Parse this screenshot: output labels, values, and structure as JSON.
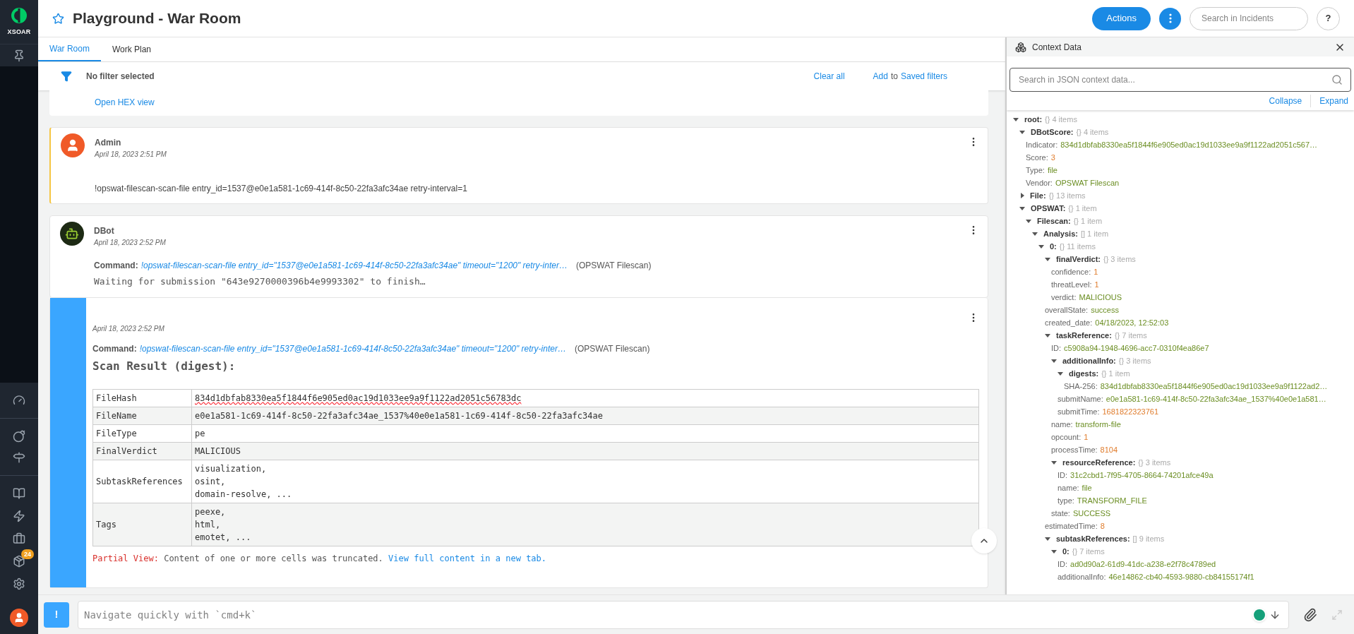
{
  "sidebar": {
    "logo_text": "XSOAR",
    "badge": "24"
  },
  "header": {
    "title": "Playground - War Room",
    "actions_button": "Actions",
    "search": {
      "placeholder": "Search in Incidents"
    },
    "help_button": "?"
  },
  "tabs": [
    {
      "label": "War Room",
      "selected": true
    },
    {
      "label": "Work Plan",
      "selected": false
    }
  ],
  "filter_bar": {
    "status": "No filter selected",
    "clear_all": "Clear all",
    "add": "Add",
    "to": "to",
    "saved_filters": "Saved filters"
  },
  "entries": [
    {
      "kind": "link",
      "link": "Open HEX view"
    },
    {
      "kind": "user",
      "author": "Admin",
      "time": "April 18, 2023 2:51 PM",
      "text": "!opswat-filescan-scan-file entry_id=1537@e0e1a581-1c69-414f-8c50-22fa3afc34ae retry-interval=1"
    },
    {
      "kind": "bot",
      "author": "DBot",
      "time": "April 18, 2023 2:52 PM",
      "command_label": "Command:",
      "command": "!opswat-filescan-scan-file entry_id=\"1537@e0e1a581-1c69-414f-8c50-22fa3afc34ae\" timeout=\"1200\" retry-inter…",
      "source": "(OPSWAT Filescan)",
      "output": "Waiting for submission \"643e9270000396b4e9993302\" to finish…"
    },
    {
      "kind": "result",
      "time": "April 18, 2023 2:52 PM",
      "command_label": "Command:",
      "command": "!opswat-filescan-scan-file entry_id=\"1537@e0e1a581-1c69-414f-8c50-22fa3afc34ae\" timeout=\"1200\" retry-inter…",
      "source": "(OPSWAT Filescan)",
      "heading": "Scan Result (digest):",
      "table": [
        {
          "key": "FileHash",
          "value": [
            "834d1dbfab8330ea5f1844f6e905ed0ac19d1033ee9a9f1122ad2051c56783dc"
          ]
        },
        {
          "key": "FileName",
          "value": [
            "e0e1a581-1c69-414f-8c50-22fa3afc34ae_1537%40e0e1a581-1c69-414f-8c50-22fa3afc34ae"
          ]
        },
        {
          "key": "FileType",
          "value": [
            "pe"
          ]
        },
        {
          "key": "FinalVerdict",
          "value": [
            "MALICIOUS"
          ]
        },
        {
          "key": "SubtaskReferences",
          "value": [
            "visualization,",
            "osint,",
            "domain-resolve, ..."
          ]
        },
        {
          "key": "Tags",
          "value": [
            "peexe,",
            "html,",
            "emotet, ..."
          ]
        }
      ],
      "partial_label": "Partial View:",
      "partial_text": "Content of one or more cells was truncated.",
      "partial_link": "View full content in a new tab."
    }
  ],
  "chat": {
    "placeholder": "Navigate quickly with `cmd+k`",
    "button": "!"
  },
  "context_panel": {
    "title": "Context Data",
    "search": {
      "placeholder": "Search in JSON context data..."
    },
    "collapse": "Collapse",
    "expand": "Expand",
    "tree": [
      {
        "key": "root:",
        "summary": "{} 4 items",
        "expanded": true,
        "children": [
          {
            "key": "DBotScore:",
            "summary": "{} 4 items",
            "expanded": true,
            "children": [
              {
                "key": "Indicator:",
                "value": "834d1dbfab8330ea5f1844f6e905ed0ac19d1033ee9a9f1122ad2051c567…",
                "kind": "string"
              },
              {
                "key": "Score:",
                "value": "3",
                "kind": "number"
              },
              {
                "key": "Type:",
                "value": "file",
                "kind": "string"
              },
              {
                "key": "Vendor:",
                "value": "OPSWAT Filescan",
                "kind": "string"
              }
            ]
          },
          {
            "key": "File:",
            "summary": "{} 13 items",
            "expanded": false
          },
          {
            "key": "OPSWAT:",
            "summary": "{} 1 item",
            "expanded": true,
            "children": [
              {
                "key": "Filescan:",
                "summary": "{} 1 item",
                "expanded": true,
                "children": [
                  {
                    "key": "Analysis:",
                    "summary": "[] 1 item",
                    "expanded": true,
                    "children": [
                      {
                        "key": "0:",
                        "summary": "{} 11 items",
                        "expanded": true,
                        "children": [
                          {
                            "key": "finalVerdict:",
                            "summary": "{} 3 items",
                            "expanded": true,
                            "children": [
                              {
                                "key": "confidence:",
                                "value": "1",
                                "kind": "number"
                              },
                              {
                                "key": "threatLevel:",
                                "value": "1",
                                "kind": "number"
                              },
                              {
                                "key": "verdict:",
                                "value": "MALICIOUS",
                                "kind": "string"
                              }
                            ]
                          },
                          {
                            "key": "overallState:",
                            "value": "success",
                            "kind": "string"
                          },
                          {
                            "key": "created_date:",
                            "value": "04/18/2023, 12:52:03",
                            "kind": "string"
                          },
                          {
                            "key": "taskReference:",
                            "summary": "{} 7 items",
                            "expanded": true,
                            "children": [
                              {
                                "key": "ID:",
                                "value": "c5908a94-1948-4696-acc7-0310f4ea86e7",
                                "kind": "string"
                              },
                              {
                                "key": "additionalInfo:",
                                "summary": "{} 3 items",
                                "expanded": true,
                                "children": [
                                  {
                                    "key": "digests:",
                                    "summary": "{} 1 item",
                                    "expanded": true,
                                    "children": [
                                      {
                                        "key": "SHA-256:",
                                        "value": "834d1dbfab8330ea5f1844f6e905ed0ac19d1033ee9a9f1122ad2…",
                                        "kind": "string"
                                      }
                                    ]
                                  },
                                  {
                                    "key": "submitName:",
                                    "value": "e0e1a581-1c69-414f-8c50-22fa3afc34ae_1537%40e0e1a581…",
                                    "kind": "string"
                                  },
                                  {
                                    "key": "submitTime:",
                                    "value": "1681822323761",
                                    "kind": "number"
                                  }
                                ]
                              },
                              {
                                "key": "name:",
                                "value": "transform-file",
                                "kind": "string"
                              },
                              {
                                "key": "opcount:",
                                "value": "1",
                                "kind": "number"
                              },
                              {
                                "key": "processTime:",
                                "value": "8104",
                                "kind": "number"
                              },
                              {
                                "key": "resourceReference:",
                                "summary": "{} 3 items",
                                "expanded": true,
                                "children": [
                                  {
                                    "key": "ID:",
                                    "value": "31c2cbd1-7f95-4705-8664-74201afce49a",
                                    "kind": "string"
                                  },
                                  {
                                    "key": "name:",
                                    "value": "file",
                                    "kind": "string"
                                  },
                                  {
                                    "key": "type:",
                                    "value": "TRANSFORM_FILE",
                                    "kind": "string"
                                  }
                                ]
                              },
                              {
                                "key": "state:",
                                "value": "SUCCESS",
                                "kind": "string"
                              }
                            ]
                          },
                          {
                            "key": "estimatedTime:",
                            "value": "8",
                            "kind": "number"
                          },
                          {
                            "key": "subtaskReferences:",
                            "summary": "[] 9 items",
                            "expanded": true,
                            "children": [
                              {
                                "key": "0:",
                                "summary": "{} 7 items",
                                "expanded": true,
                                "children": [
                                  {
                                    "key": "ID:",
                                    "value": "ad0d90a2-61d9-41dc-a238-e2f78c4789ed",
                                    "kind": "string"
                                  },
                                  {
                                    "key": "additionalInfo:",
                                    "value": "46e14862-cb40-4593-9880-cb84155174f1",
                                    "kind": "string"
                                  }
                                ]
                              }
                            ]
                          }
                        ]
                      }
                    ]
                  }
                ]
              }
            ]
          }
        ]
      }
    ]
  }
}
